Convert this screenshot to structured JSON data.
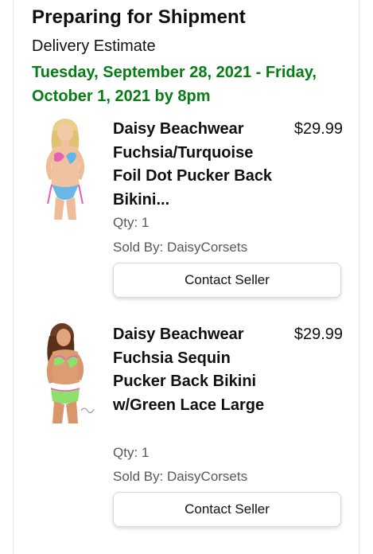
{
  "section": {
    "title": "Preparing for Shipment",
    "estimate_label": "Delivery Estimate",
    "estimate_date": "Tuesday, September 28, 2021 - Friday, October 1, 2021 by 8pm",
    "estimate_color": "#067d15"
  },
  "items": [
    {
      "title": "Daisy Beachwear Fuchsia/Turquoise Foil Dot Pucker Back Bikini...",
      "price": "$29.99",
      "qty": "Qty: 1",
      "sold_by": "Sold By: DaisyCorsets",
      "button": "Contact Seller"
    },
    {
      "title": "Daisy Beachwear Fuchsia Sequin Pucker Back Bikini w/Green Lace Large",
      "price": "$29.99",
      "qty": "Qty: 1",
      "sold_by": "Sold By: DaisyCorsets",
      "button": "Contact Seller"
    }
  ]
}
